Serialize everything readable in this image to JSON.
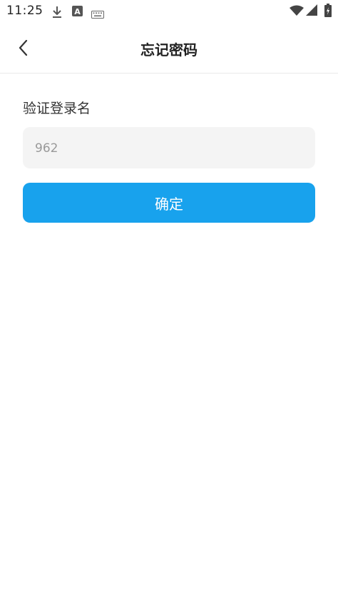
{
  "status_bar": {
    "time": "11:25",
    "icons": [
      "download-icon",
      "a-badge-icon",
      "keyboard-icon",
      "wifi-icon",
      "signal-icon",
      "battery-charging-icon"
    ]
  },
  "header": {
    "title": "忘记密码",
    "back_icon": "chevron-left-icon"
  },
  "form": {
    "label": "验证登录名",
    "input_value": "962",
    "input_placeholder": "",
    "submit_label": "确定"
  },
  "colors": {
    "accent": "#18a2ed",
    "input_bg": "#f4f4f4"
  }
}
